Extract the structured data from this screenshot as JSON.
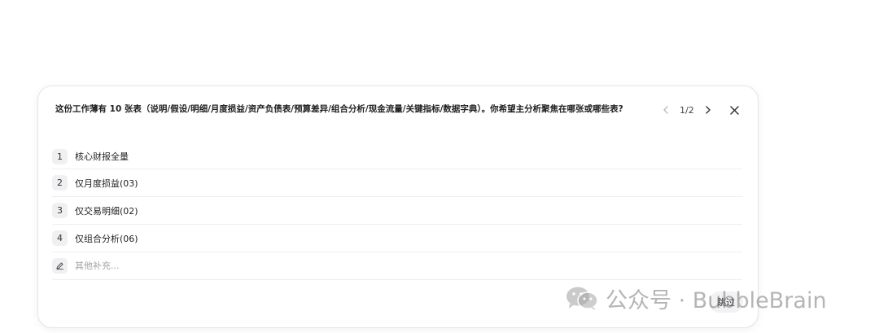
{
  "question": {
    "text": "这份工作薄有 10 张表（说明/假设/明细/月度损益/资产负债表/预算差异/组合分析/现金流量/关键指标/数据字典）。你希望主分析聚焦在哪张或哪些表?"
  },
  "pager": {
    "indicator": "1/2",
    "prev_icon": "chevron-left-icon",
    "next_icon": "chevron-right-icon"
  },
  "close_icon": "close-icon",
  "options": [
    {
      "num": "1",
      "label": "核心财报全量"
    },
    {
      "num": "2",
      "label": "仅月度损益(03)"
    },
    {
      "num": "3",
      "label": "仅交易明细(02)"
    },
    {
      "num": "4",
      "label": "仅组合分析(06)"
    }
  ],
  "other": {
    "icon": "pencil-icon",
    "placeholder": "其他补充..."
  },
  "skip_label": "跳过",
  "watermark": {
    "icon": "wechat-icon",
    "text": "公众号 · BubbleBrain"
  }
}
